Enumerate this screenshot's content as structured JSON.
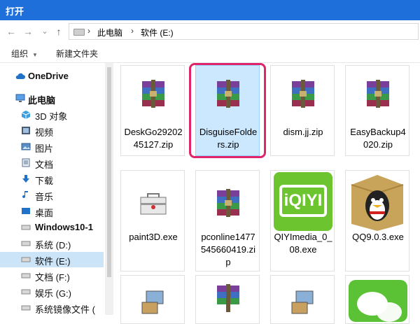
{
  "window": {
    "title": "打开"
  },
  "nav": {
    "back_icon": "arrow-left-icon",
    "forward_icon": "arrow-right-icon",
    "recent_icon": "chevron-down-icon",
    "up_icon": "arrow-up-icon",
    "back": "←",
    "forward": "→",
    "recent": "⌄",
    "up": "↑",
    "sep1": "›",
    "sep2": "›",
    "crumbs": [
      "此电脑",
      "软件 (E:)"
    ]
  },
  "toolbar": {
    "organize": "组织",
    "new_folder": "新建文件夹"
  },
  "sidebar": {
    "items": [
      {
        "label": "OneDrive",
        "icon": "cloud-icon"
      },
      {
        "label": "此电脑",
        "icon": "computer-icon"
      },
      {
        "label": "3D 对象",
        "icon": "cube-icon"
      },
      {
        "label": "视频",
        "icon": "video-icon"
      },
      {
        "label": "图片",
        "icon": "picture-icon"
      },
      {
        "label": "文档",
        "icon": "document-icon"
      },
      {
        "label": "下载",
        "icon": "download-icon"
      },
      {
        "label": "音乐",
        "icon": "music-icon"
      },
      {
        "label": "桌面",
        "icon": "desktop-icon"
      },
      {
        "label": "Windows10-1",
        "icon": "drive-icon"
      },
      {
        "label": "系统 (D:)",
        "icon": "drive-icon"
      },
      {
        "label": "软件 (E:)",
        "icon": "drive-icon"
      },
      {
        "label": "文档 (F:)",
        "icon": "drive-icon"
      },
      {
        "label": "娱乐 (G:)",
        "icon": "drive-icon"
      },
      {
        "label": "系统镜像文件 (",
        "icon": "drive-icon"
      }
    ]
  },
  "files": [
    {
      "name": "DeskGo2920245127.zip",
      "icon": "winrar-archive-icon"
    },
    {
      "name": "DisguiseFolders.zip",
      "icon": "winrar-archive-icon"
    },
    {
      "name": "dism.jj.zip",
      "icon": "winrar-archive-icon"
    },
    {
      "name": "EasyBackup4020.zip",
      "icon": "winrar-archive-icon"
    },
    {
      "name": "paint3D.exe",
      "icon": "toolbox-icon"
    },
    {
      "name": "pconline1477545660419.zip",
      "icon": "winrar-archive-icon"
    },
    {
      "name": "QIYImedia_0_08.exe",
      "icon": "iqiyi-icon"
    },
    {
      "name": "QQ9.0.3.exe",
      "icon": "qq-penguin-icon"
    },
    {
      "name": "",
      "icon": "installer-icon"
    },
    {
      "name": "",
      "icon": "winrar-archive-icon"
    },
    {
      "name": "",
      "icon": "installer-icon"
    },
    {
      "name": "",
      "icon": "wechat-icon"
    }
  ],
  "iqiyi_logo": "iQIYI",
  "colors": {
    "titlebar": "#1e6fd9",
    "selection": "#cce4f7",
    "highlight": "#e0246b",
    "iqiyi": "#6cc42e"
  }
}
